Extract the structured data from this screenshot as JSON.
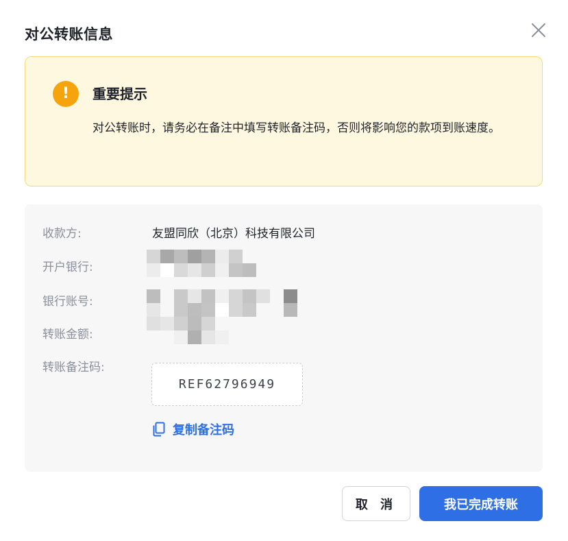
{
  "dialog": {
    "title": "对公转账信息",
    "close_icon": "close-icon"
  },
  "notice": {
    "icon": "warning-icon",
    "icon_glyph": "!",
    "title": "重要提示",
    "body": "对公转账时，请务必在备注中填写转账备注码，否则将影响您的款项到账速度。"
  },
  "info": {
    "payee_label": "收款方:",
    "payee_value": "友盟同欣（北京）科技有限公司",
    "bank_label": "开户银行:",
    "account_label": "银行账号:",
    "amount_label": "转账金额:",
    "ref_label": "转账备注码:",
    "ref_code": "REF62796949",
    "copy_label": "复制备注码",
    "copy_icon": "copy-icon",
    "redacted_fields": [
      "bank_name",
      "account_number",
      "amount"
    ]
  },
  "footer": {
    "cancel_label": "取 消",
    "confirm_label": "我已完成转账"
  },
  "colors": {
    "primary": "#2f6fe6",
    "warning": "#f5a40c",
    "notice_bg": "#fff8e0",
    "notice_border": "#f5d97a",
    "panel_bg": "#f7f7f8"
  }
}
